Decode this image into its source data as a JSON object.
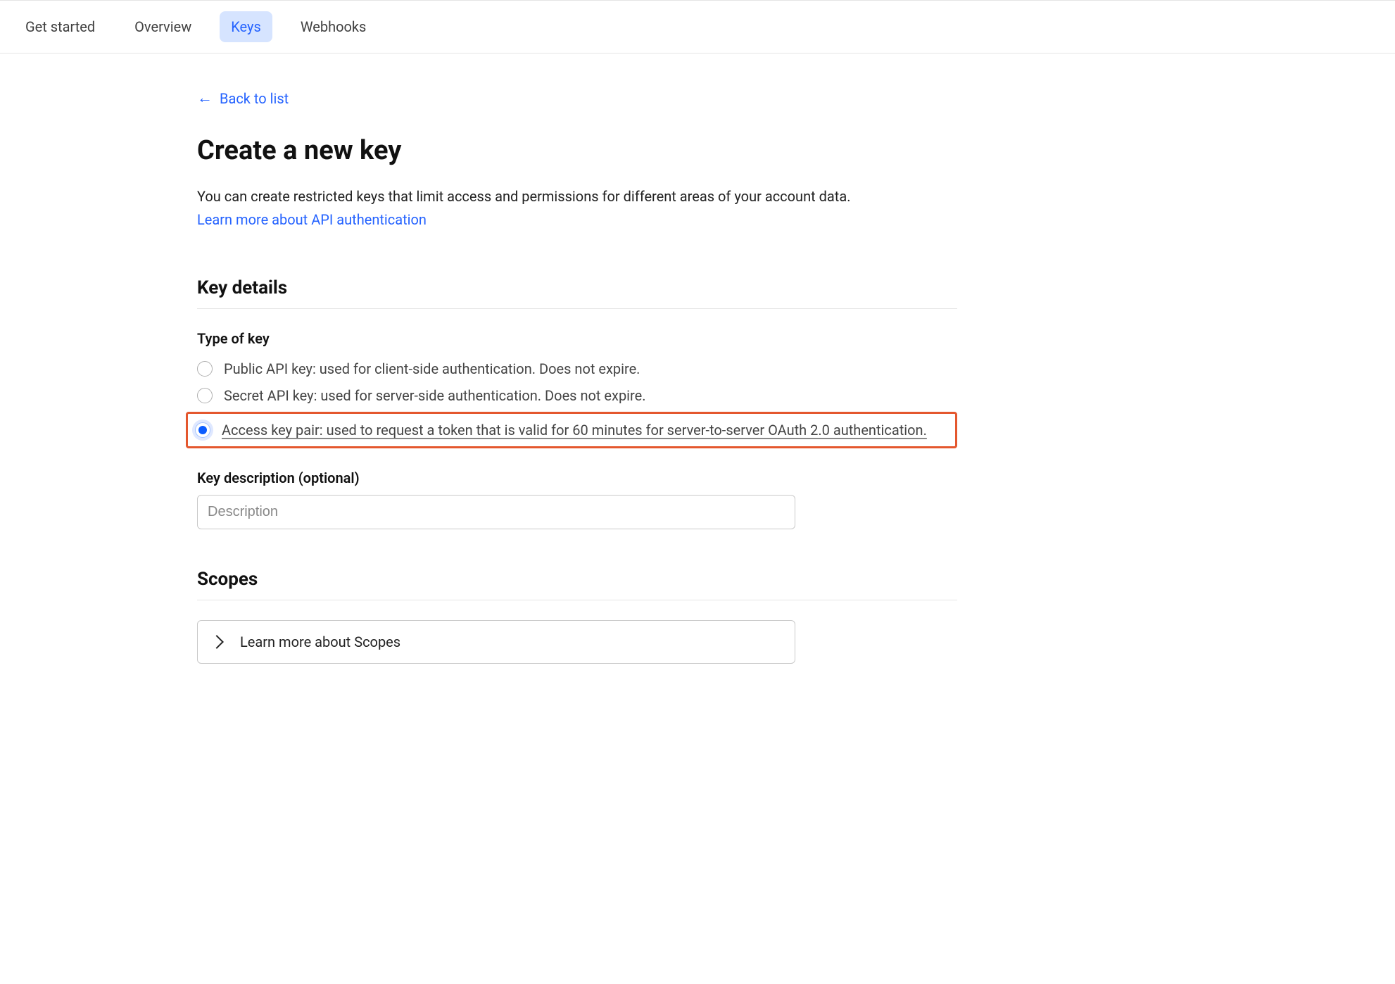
{
  "tabs": {
    "items": [
      {
        "label": "Get started",
        "active": false
      },
      {
        "label": "Overview",
        "active": false
      },
      {
        "label": "Keys",
        "active": true
      },
      {
        "label": "Webhooks",
        "active": false
      }
    ]
  },
  "back": {
    "label": "Back to list"
  },
  "page": {
    "title": "Create a new key",
    "description": "You can create restricted keys that limit access and permissions for different areas of your account data.",
    "learn_more": "Learn more about API authentication"
  },
  "sections": {
    "key_details": "Key details",
    "scopes": "Scopes"
  },
  "type_of_key": {
    "label": "Type of key",
    "options": [
      {
        "label": "Public API key: used for client-side authentication. Does not expire.",
        "selected": false
      },
      {
        "label": "Secret API key: used for server-side authentication. Does not expire.",
        "selected": false
      },
      {
        "label": "Access key pair: used to request a token that is valid for 60 minutes for server-to-server OAuth 2.0 authentication.",
        "selected": true
      }
    ]
  },
  "key_description": {
    "label": "Key description (optional)",
    "placeholder": "Description",
    "value": ""
  },
  "scopes_expand": {
    "label": "Learn more about Scopes"
  }
}
